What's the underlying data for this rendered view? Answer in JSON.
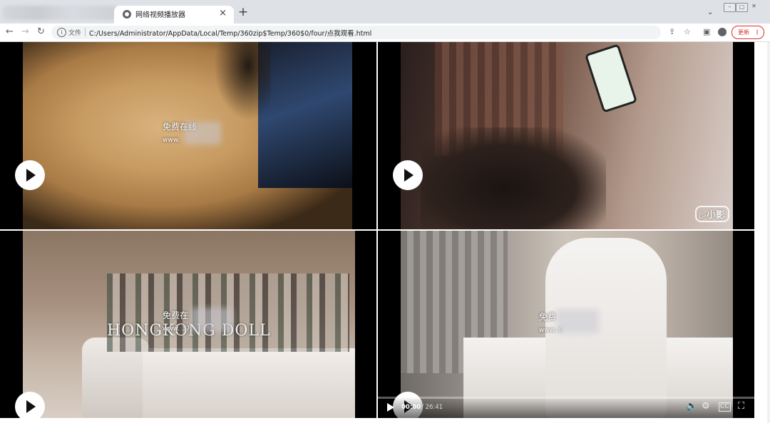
{
  "browser": {
    "active_tab_title": "网络视频播放器",
    "tab_close": "×",
    "new_tab": "+",
    "tab_search": "⌄",
    "file_label": "文件",
    "url": "C:/Users/Administrator/AppData/Local/Temp/360zip$Temp/360$0/four/点我观看.html",
    "update_label": "更新",
    "update_dots": "⋮"
  },
  "videos": [
    {
      "overlay_line1": "免费在线",
      "overlay_line2": "www."
    },
    {
      "watermark": "▷小影"
    },
    {
      "overlay_line1": "免费在",
      "overlay_line2": "www. 37",
      "scene_title": "HONGKONG DOLL"
    },
    {
      "overlay_line1": "免费",
      "overlay_line2": "www. 6"
    }
  ],
  "player": {
    "current_time": "00:00",
    "total_time": "/ 26:41",
    "progress": 0.0
  },
  "icons": {
    "back": "←",
    "forward": "→",
    "reload": "↻",
    "info": "i",
    "share": "⇪",
    "star": "☆",
    "reading": "▣",
    "volume": "🔈",
    "settings": "⚙",
    "captions": "CC",
    "fullscreen": "⛶"
  }
}
